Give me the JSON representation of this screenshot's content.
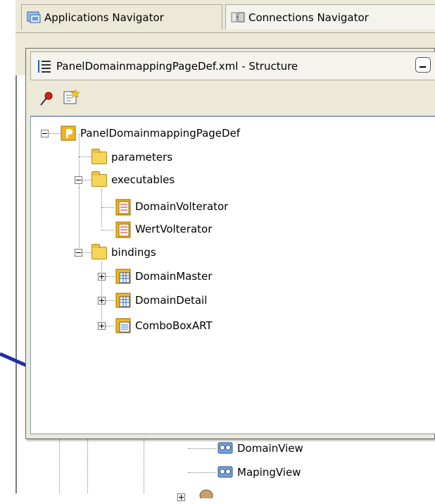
{
  "navigator_tabs": [
    {
      "label": "Applications Navigator",
      "icon": "applications-navigator-icon"
    },
    {
      "label": "Connections Navigator",
      "icon": "connections-navigator-icon"
    }
  ],
  "structure_window": {
    "title": "PanelDomainmappingPageDef.xml - Structure",
    "toolbar": [
      {
        "name": "pin-icon"
      },
      {
        "name": "edit-properties-icon"
      }
    ],
    "tree": {
      "root": "PanelDomainmappingPageDef",
      "parameters": "parameters",
      "executables": "executables",
      "exec_items": [
        "DomainVolterator",
        "WertVolterator"
      ],
      "bindings": "bindings",
      "binding_items": [
        "DomainMaster",
        "DomainDetail",
        "ComboBoxART"
      ]
    }
  },
  "background_tree": {
    "items": [
      "DomainView",
      "MapingView"
    ]
  },
  "colors": {
    "window_bg": "#ece9d8",
    "arrow": "#1f2fa8",
    "folder": "#f3d65a"
  }
}
